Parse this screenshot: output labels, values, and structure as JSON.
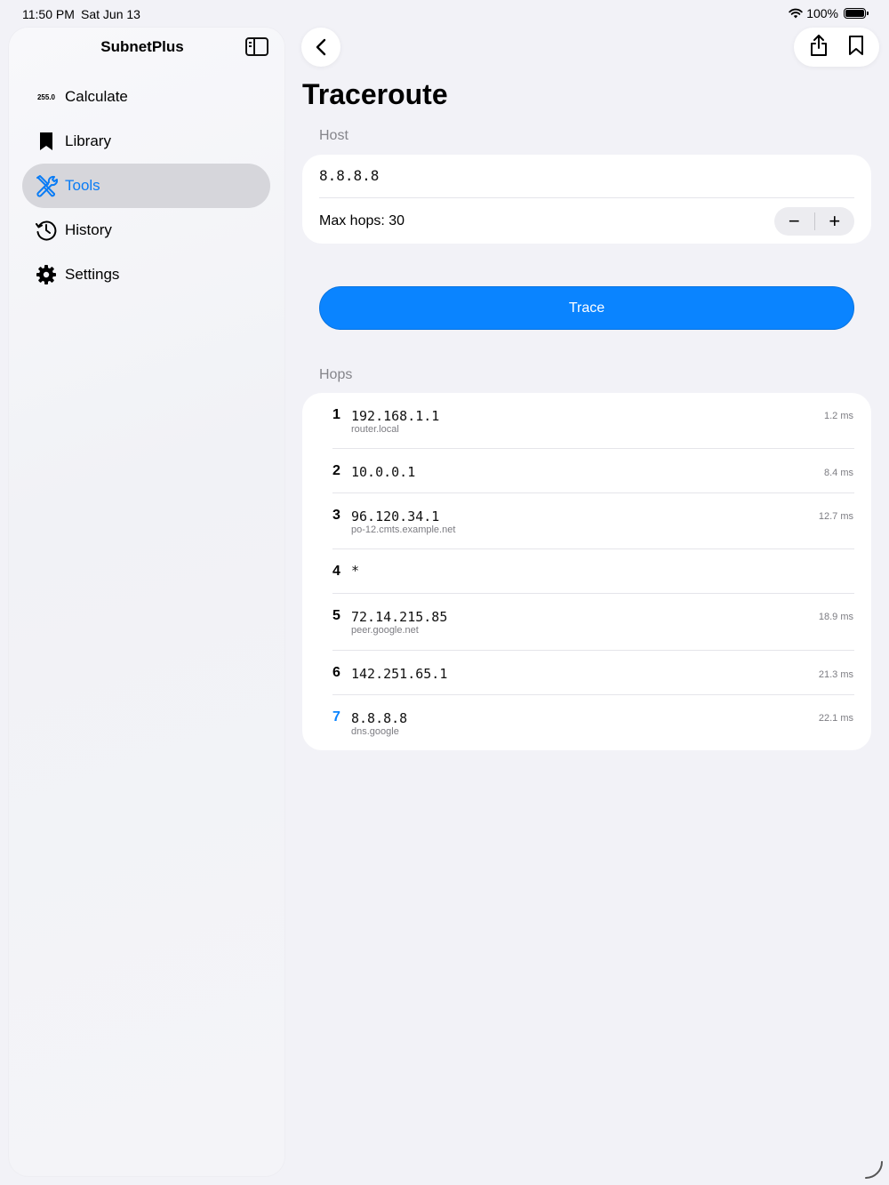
{
  "status_bar": {
    "time": "11:50 PM",
    "date": "Sat Jun 13",
    "battery": "100%"
  },
  "sidebar": {
    "title": "SubnetPlus",
    "items": [
      {
        "label": "Calculate",
        "icon": "255.0"
      },
      {
        "label": "Library",
        "icon": "bookmark-icon"
      },
      {
        "label": "Tools",
        "icon": "tools-icon",
        "active": true
      },
      {
        "label": "History",
        "icon": "history-icon"
      },
      {
        "label": "Settings",
        "icon": "gear-icon"
      }
    ]
  },
  "main": {
    "title": "Traceroute",
    "host_section_label": "Host",
    "host_value": "8.8.8.8",
    "max_hops_label": "Max hops: 30",
    "stepper_minus": "−",
    "stepper_plus": "+",
    "trace_button": "Trace",
    "hops_section_label": "Hops",
    "hops": [
      {
        "num": "1",
        "ip": "192.168.1.1",
        "host": "router.local",
        "time": "1.2 ms"
      },
      {
        "num": "2",
        "ip": "10.0.0.1",
        "host": "",
        "time": "8.4 ms"
      },
      {
        "num": "3",
        "ip": "96.120.34.1",
        "host": "po-12.cmts.example.net",
        "time": "12.7 ms"
      },
      {
        "num": "4",
        "ip": "*",
        "host": "",
        "time": ""
      },
      {
        "num": "5",
        "ip": "72.14.215.85",
        "host": "peer.google.net",
        "time": "18.9 ms"
      },
      {
        "num": "6",
        "ip": "142.251.65.1",
        "host": "",
        "time": "21.3 ms"
      },
      {
        "num": "7",
        "ip": "8.8.8.8",
        "host": "dns.google",
        "time": "22.1 ms"
      }
    ]
  },
  "colors": {
    "accent": "#0a84ff",
    "background": "#f2f2f7",
    "card": "#ffffff"
  }
}
